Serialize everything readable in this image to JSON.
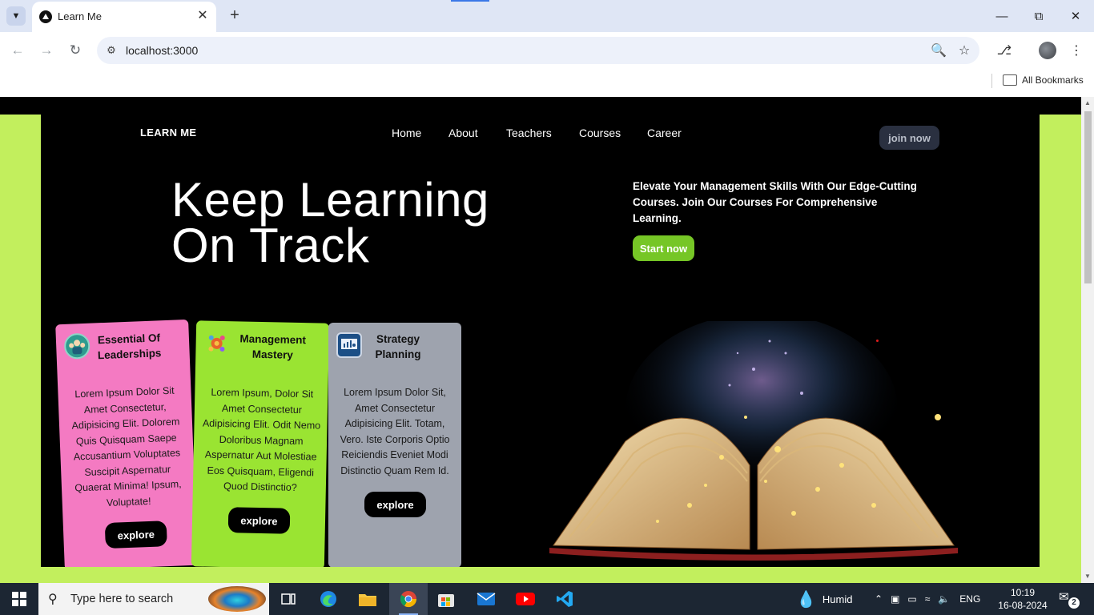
{
  "browser": {
    "tab_title": "Learn Me",
    "url": "localhost:3000",
    "bookmarks_label": "All Bookmarks"
  },
  "site": {
    "brand": "LEARN ME",
    "nav": [
      "Home",
      "About",
      "Teachers",
      "Courses",
      "Career"
    ],
    "join_label": "join now",
    "headline_line1": "Keep Learning",
    "headline_line2": "On Track",
    "tagline": "Elevate Your Management Skills With Our Edge-Cutting Courses. Join Our Courses For Comprehensive Learning.",
    "start_label": "Start now",
    "cards": [
      {
        "title": "Essential Of Leaderships",
        "body": "Lorem Ipsum Dolor Sit Amet Consectetur, Adipisicing Elit. Dolorem Quis Quisquam Saepe Accusantium Voluptates Suscipit Aspernatur Quaerat Minima! Ipsum, Voluptate!",
        "button": "explore",
        "color": "#f47ac2",
        "icon": "leadership-icon"
      },
      {
        "title": "Management Mastery",
        "body": "Lorem Ipsum, Dolor Sit Amet Consectetur Adipisicing Elit. Odit Nemo Doloribus Magnam Aspernatur Aut Molestiae Eos Quisquam, Eligendi Quod Distinctio?",
        "button": "explore",
        "color": "#9ae432",
        "icon": "gear-flower-icon"
      },
      {
        "title": "Strategy Planning",
        "body": "Lorem Ipsum Dolor Sit, Amet Consectetur Adipisicing Elit. Totam, Vero. Iste Corporis Optio Reiciendis Eveniet Modi Distinctio Quam Rem Id.",
        "button": "explore",
        "color": "#9ea3ae",
        "icon": "strategy-board-icon"
      }
    ],
    "colors": {
      "lime": "#c2ef5d",
      "hero_bg": "#000000",
      "start_button": "#76c626",
      "join_button": "#2a3040"
    }
  },
  "taskbar": {
    "search_placeholder": "Type here to search",
    "weather": "Humid",
    "language": "ENG",
    "time": "10:19",
    "date": "16-08-2024",
    "notification_count": "2"
  }
}
